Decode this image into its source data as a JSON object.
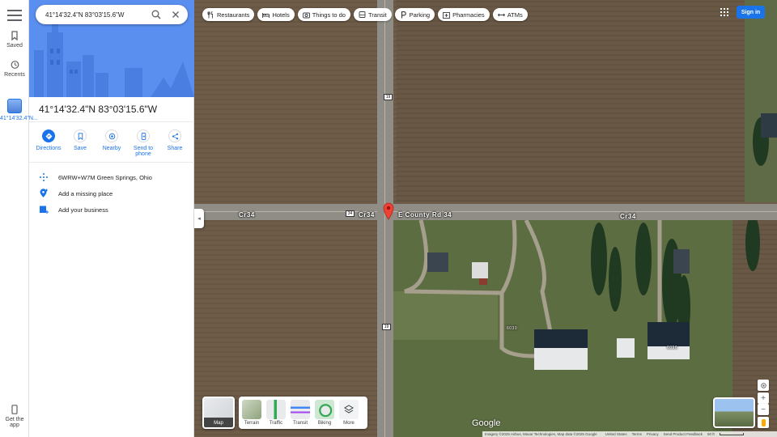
{
  "rail": {
    "saved": "Saved",
    "recents": "Recents",
    "place": "41°14'32.4\"N...",
    "get_app": "Get the app"
  },
  "search": {
    "value": "41°14'32.4\"N 83°03'15.6\"W"
  },
  "place": {
    "title": "41°14'32.4\"N 83°03'15.6\"W",
    "actions": [
      "Directions",
      "Save",
      "Nearby",
      "Send to phone",
      "Share"
    ],
    "plus_code": "6WRW+W7M Green Springs, Ohio",
    "add_missing": "Add a missing place",
    "add_business": "Add your business"
  },
  "chips": [
    {
      "label": "Restaurants",
      "icon": "fork-knife-icon"
    },
    {
      "label": "Hotels",
      "icon": "bed-icon"
    },
    {
      "label": "Things to do",
      "icon": "camera-icon"
    },
    {
      "label": "Transit",
      "icon": "bus-icon"
    },
    {
      "label": "Parking",
      "icon": "parking-icon"
    },
    {
      "label": "Pharmacies",
      "icon": "pharmacy-icon"
    },
    {
      "label": "ATMs",
      "icon": "atm-icon"
    }
  ],
  "signin": "Sign in",
  "map": {
    "road_labels": [
      "Cr34",
      "Cr34",
      "E County Rd 34",
      "Cr34"
    ],
    "shields": [
      "19",
      "34",
      "19"
    ],
    "house_numbers": [
      "6030",
      "6096"
    ],
    "google": "Google"
  },
  "layers": {
    "map": "Map",
    "items": [
      "Terrain",
      "Traffic",
      "Transit",
      "Biking",
      "More"
    ]
  },
  "controls": {
    "zoom_in": "+",
    "zoom_out": "−"
  },
  "attribution": {
    "imagery": "Imagery ©2025 Airbus, Maxar Technologies, Map data ©2025 Google",
    "country": "United States",
    "terms": "Terms",
    "privacy": "Privacy",
    "feedback": "Send Product Feedback",
    "scale": "50 ft"
  },
  "colors": {
    "accent": "#1a73e8",
    "pin": "#ea4335",
    "hero": "#5a8ff0"
  }
}
